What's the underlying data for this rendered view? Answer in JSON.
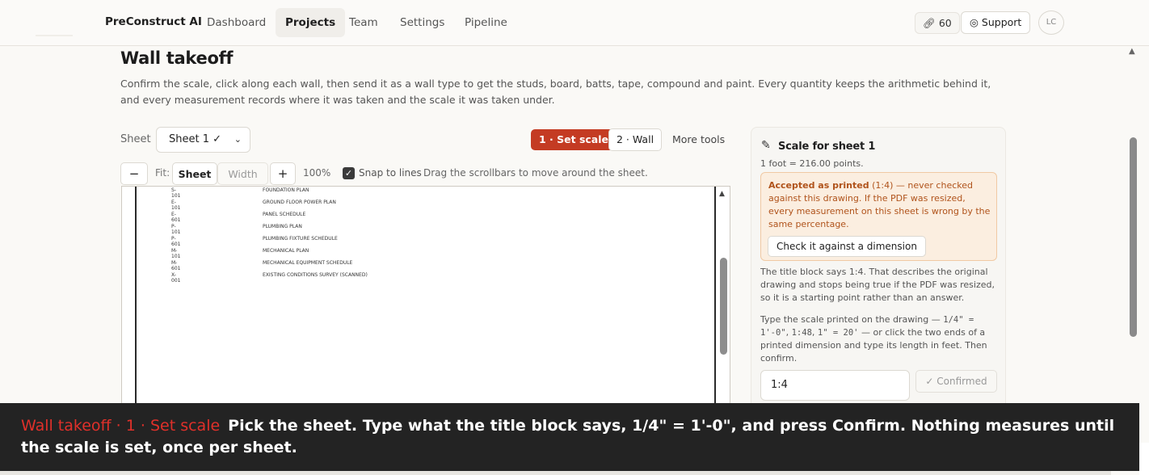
{
  "nav": {
    "brand": "PreConstruct AI",
    "items": [
      {
        "label": "Dashboard",
        "active": false
      },
      {
        "label": "Projects",
        "active": true
      },
      {
        "label": "Team",
        "active": false
      },
      {
        "label": "Settings",
        "active": false
      },
      {
        "label": "Pipeline",
        "active": false
      }
    ],
    "credits": "60",
    "credits_icon": "link-icon",
    "support_label": "Support",
    "support_icon": "lifebuoy-icon",
    "avatar": "LC"
  },
  "page": {
    "title": "Wall takeoff",
    "description": "Confirm the scale, click along each wall, then send it as a wall type to get the studs, board, batts, tape, compound and paint. Every quantity keeps the arithmetic behind it, and every measurement records where it was taken and the scale it was taken under."
  },
  "controls": {
    "sheet_label": "Sheet",
    "sheet_value": "Sheet 1 ✓",
    "step1": "1 · Set scale",
    "step2": "2 · Wall",
    "more_tools": "More tools",
    "zoom_out": "−",
    "fit_label": "Fit:",
    "fit_sheet": "Sheet",
    "fit_width": "Width",
    "zoom_in": "+",
    "zoom_level": "100%",
    "snap_label": "Snap to lines",
    "snap_checked": true,
    "drag_hint": "Drag the scrollbars to move around the sheet."
  },
  "drawing_index": [
    {
      "code": "S-101",
      "name": "FOUNDATION PLAN"
    },
    {
      "code": "E-101",
      "name": "GROUND FLOOR POWER PLAN"
    },
    {
      "code": "E-601",
      "name": "PANEL SCHEDULE"
    },
    {
      "code": "P-101",
      "name": "PLUMBING PLAN"
    },
    {
      "code": "P-601",
      "name": "PLUMBING FIXTURE SCHEDULE"
    },
    {
      "code": "M-101",
      "name": "MECHANICAL PLAN"
    },
    {
      "code": "M-601",
      "name": "MECHANICAL EQUIPMENT SCHEDULE"
    },
    {
      "code": "X-001",
      "name": "EXISTING CONDITIONS SURVEY (SCANNED)"
    }
  ],
  "panel": {
    "title": "Scale for sheet 1",
    "subtitle": "1 foot = 216.00 points.",
    "warn_strong": "Accepted as printed",
    "warn_rest": " (1:4) — never checked against this drawing. If the PDF was resized, every measurement on this sheet is wrong by the same percentage.",
    "check_button": "Check it against a dimension",
    "para1": "The title block says 1:4. That describes the original drawing and stops being true if the PDF was resized, so it is a starting point rather than an answer.",
    "para2_a": "Type the scale printed on the drawing — ",
    "para2_m1": "1/4\" = 1'-0\"",
    "para2_b": ", ",
    "para2_m2": "1:48",
    "para2_c": ", ",
    "para2_m3": "1\" = 20'",
    "para2_d": " — or click the two ends of a printed dimension and type its length in feet. Then confirm.",
    "scale_value": "1:4",
    "confirmed_label": "✓ Confirmed"
  },
  "caption": {
    "tag": "Wall takeoff · 1 · Set scale",
    "text": "Pick the sheet. Type what the title block says, 1/4\" = 1'-0\", and press Confirm. Nothing measures until the scale is set, once per sheet."
  }
}
